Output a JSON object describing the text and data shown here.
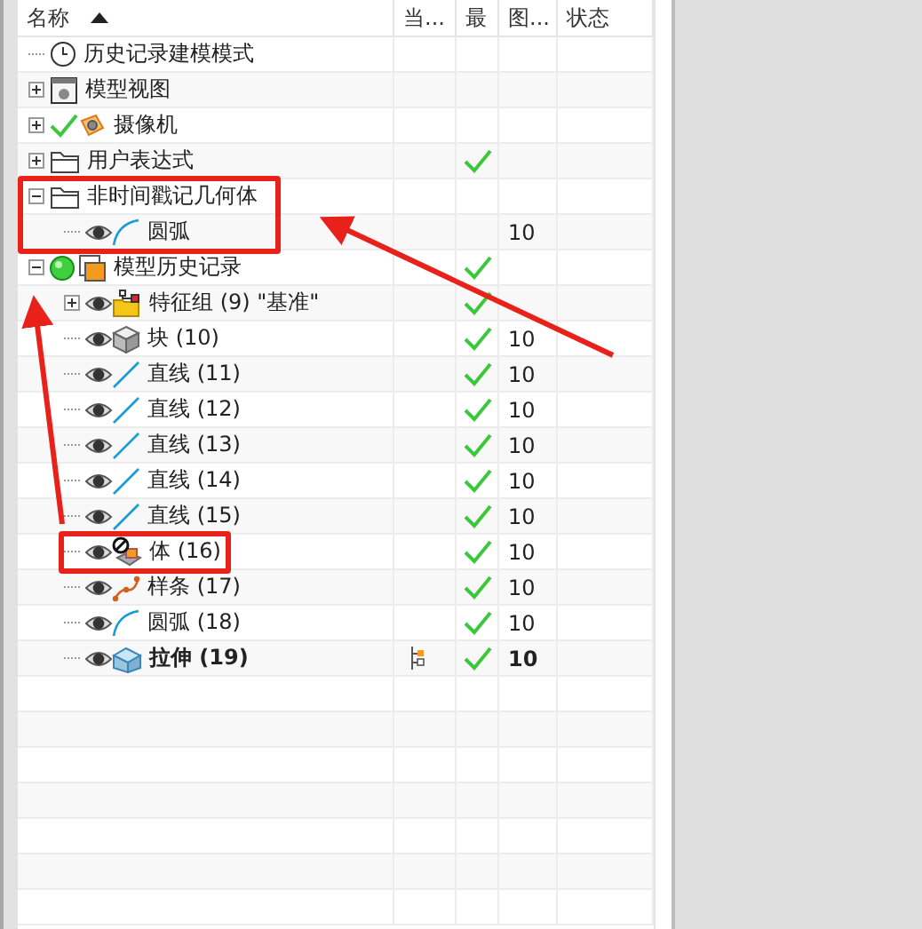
{
  "table": {
    "columns": [
      {
        "label": "名称",
        "sorted": true
      },
      {
        "label": "当..."
      },
      {
        "label": "最"
      },
      {
        "label": "图..."
      },
      {
        "label": "状态"
      }
    ],
    "rows": [
      {
        "kind": "clock",
        "label": "历史记录建模模式"
      },
      {
        "kind": "view",
        "label": "模型视图",
        "expanded": false
      },
      {
        "kind": "camera",
        "label": "摄像机",
        "expanded": false,
        "checked": true
      },
      {
        "kind": "folder",
        "label": "用户表达式",
        "expanded": false,
        "latest": true
      },
      {
        "kind": "folder",
        "label": "非时间戳记几何体",
        "expanded": true,
        "highlighted": true,
        "children": [
          {
            "kind": "arc",
            "label": "圆弧",
            "visible": true,
            "layer": "10"
          }
        ]
      },
      {
        "kind": "history",
        "label": "模型历史记录",
        "expanded": true,
        "latest": true,
        "children": [
          {
            "kind": "group",
            "label": "特征组 (9) \"基准\"",
            "expanded": false,
            "visible": true,
            "latest": true
          },
          {
            "kind": "block",
            "label": "块 (10)",
            "visible": true,
            "latest": true,
            "layer": "10"
          },
          {
            "kind": "line",
            "label": "直线 (11)",
            "visible": true,
            "latest": true,
            "layer": "10"
          },
          {
            "kind": "line",
            "label": "直线 (12)",
            "visible": true,
            "latest": true,
            "layer": "10"
          },
          {
            "kind": "line",
            "label": "直线 (13)",
            "visible": true,
            "latest": true,
            "layer": "10"
          },
          {
            "kind": "line",
            "label": "直线 (14)",
            "visible": true,
            "latest": true,
            "layer": "10"
          },
          {
            "kind": "line",
            "label": "直线 (15)",
            "visible": true,
            "latest": true,
            "layer": "10"
          },
          {
            "kind": "body",
            "label": "体 (16)",
            "visible": true,
            "latest": true,
            "layer": "10",
            "highlighted": true
          },
          {
            "kind": "spline",
            "label": "样条 (17)",
            "visible": true,
            "latest": true,
            "layer": "10"
          },
          {
            "kind": "arc",
            "label": "圆弧 (18)",
            "visible": true,
            "latest": true,
            "layer": "10"
          },
          {
            "kind": "extrude",
            "label": "拉伸 (19)",
            "visible": true,
            "latest": true,
            "layer": "10",
            "current": true
          }
        ]
      }
    ]
  }
}
